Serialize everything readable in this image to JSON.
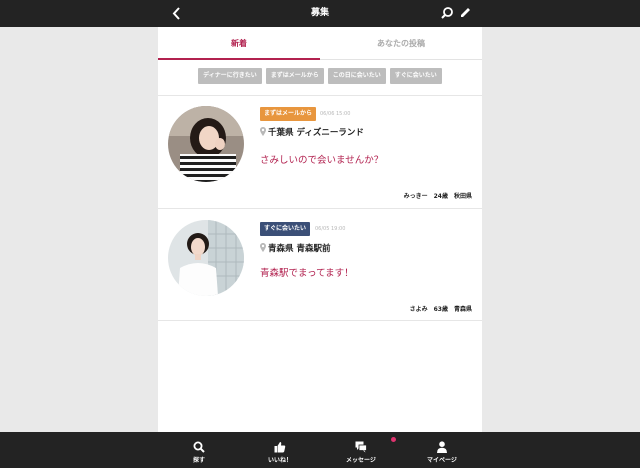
{
  "header": {
    "title": "募集",
    "back_icon": "chevron-left-icon",
    "search_icon": "search-icon",
    "compose_icon": "pencil-icon"
  },
  "tabs": [
    {
      "label": "新着",
      "active": true
    },
    {
      "label": "あなたの投稿",
      "active": false
    }
  ],
  "filters": [
    "ディナーに行きたい",
    "まずはメールから",
    "この日に会いたい",
    "すぐに会いたい"
  ],
  "posts": [
    {
      "badge": "まずはメールから",
      "badge_color": "#e8963e",
      "time": "06/06 15:00",
      "location": "千葉県 ディズニーランド",
      "message": "さみしいので会いませんか？",
      "name": "みっきー",
      "age": "24歳",
      "area": "秋田県"
    },
    {
      "badge": "すぐに会いたい",
      "badge_color": "#3b4f77",
      "time": "06/05 19:00",
      "location": "青森県 青森駅前",
      "message": "青森駅でまってます！",
      "name": "さよみ",
      "age": "63歳",
      "area": "青森県"
    }
  ],
  "bottom_nav": [
    {
      "label": "探す",
      "icon": "search-icon"
    },
    {
      "label": "いいね！",
      "icon": "thumbs-up-icon"
    },
    {
      "label": "メッセージ",
      "icon": "chat-icon",
      "has_notification": true
    },
    {
      "label": "マイページ",
      "icon": "user-icon"
    }
  ],
  "colors": {
    "accent": "#b2214f",
    "bar": "#232323",
    "notification": "#e0336f"
  }
}
